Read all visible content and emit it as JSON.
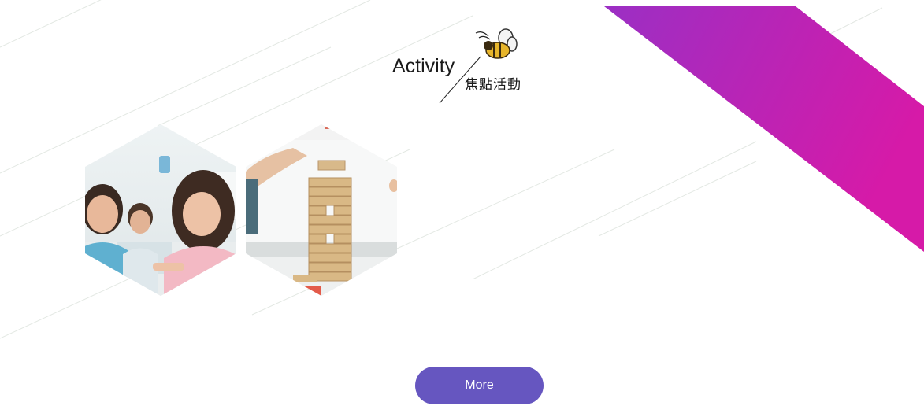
{
  "section": {
    "title_en": "Activity",
    "title_zh": "焦點活動"
  },
  "gallery": {
    "images": [
      {
        "icon": "children-playing-image"
      },
      {
        "icon": "block-tower-game-image"
      }
    ]
  },
  "more_button": {
    "label": "More"
  },
  "colors": {
    "band_start": "#9b2fc4",
    "band_end": "#d61aa8",
    "button": "#6656c0"
  }
}
